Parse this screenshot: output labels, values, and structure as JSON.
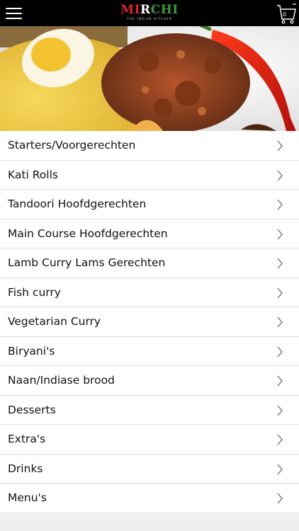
{
  "header": {
    "logo_parts": [
      "MI",
      "R",
      "CH",
      "I"
    ],
    "tagline": "THE INDIAN KITCHEN",
    "cart_count": "0",
    "icons": [
      "menu-hamburger-icon",
      "shopping-cart-icon"
    ]
  },
  "colors": {
    "topbar": "#000000",
    "logo_red": "#d8262c",
    "logo_green": "#3a9a3f",
    "list_bg": "#ffffff",
    "divider": "#dedede",
    "page_bg": "#efefef"
  },
  "hero": {
    "subject": "food-photo-biryani-with-egg-curry-and-red-chili"
  },
  "menu": {
    "items": [
      {
        "label": "Starters/Voorgerechten"
      },
      {
        "label": "Kati Rolls"
      },
      {
        "label": "Tandoori Hoofdgerechten"
      },
      {
        "label": "Main Course Hoofdgerechten"
      },
      {
        "label": "Lamb Curry Lams Gerechten"
      },
      {
        "label": "Fish curry"
      },
      {
        "label": "Vegetarian Curry"
      },
      {
        "label": "Biryani's"
      },
      {
        "label": "Naan/Indiase brood"
      },
      {
        "label": "Desserts"
      },
      {
        "label": "Extra's"
      },
      {
        "label": "Drinks"
      },
      {
        "label": "Menu's"
      }
    ]
  }
}
